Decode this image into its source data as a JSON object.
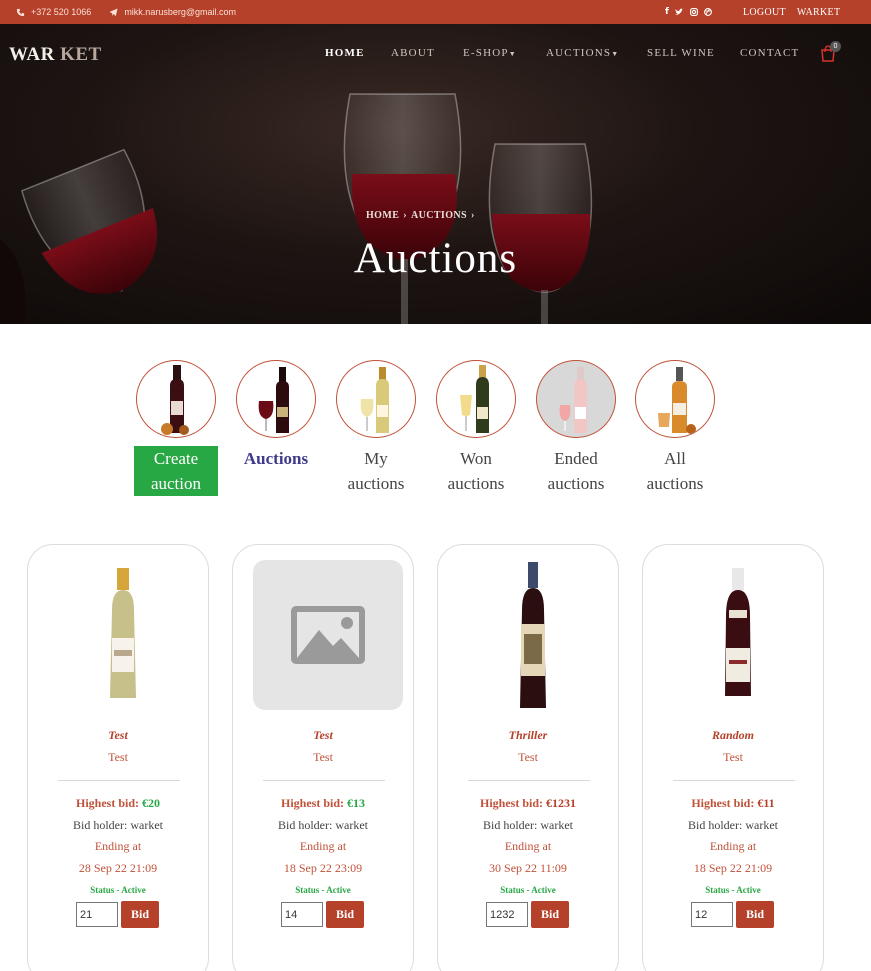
{
  "topbar": {
    "phone": "+372 520 1066",
    "email": "mikk.narusberg@gmail.com",
    "social_icons": [
      "facebook-icon",
      "twitter-icon",
      "instagram-icon",
      "dribbble-icon"
    ],
    "logout": "LOGOUT",
    "user": "WARKET"
  },
  "header": {
    "brand_part1": "WAR",
    "brand_part2": "KET",
    "nav": {
      "home": "HOME",
      "about": "ABOUT",
      "eshop": "E-SHOP",
      "auctions": "AUCTIONS",
      "sell": "SELL WINE",
      "contact": "CONTACT"
    },
    "cart_count": "0"
  },
  "hero": {
    "crumb_home": "HOME",
    "crumb_auctions": "AUCTIONS",
    "title": "Auctions"
  },
  "categories": [
    {
      "line1": "Create",
      "line2": "auction"
    },
    {
      "line1": "Auctions",
      "line2": ""
    },
    {
      "line1": "My",
      "line2": "auctions"
    },
    {
      "line1": "Won",
      "line2": "auctions"
    },
    {
      "line1": "Ended",
      "line2": "auctions"
    },
    {
      "line1": "All",
      "line2": "auctions"
    }
  ],
  "auctions": [
    {
      "name": "Test",
      "desc": "Test",
      "highest_label": "Highest bid:",
      "amount": "€20",
      "holder": "Bid holder: warket",
      "ending_label": "Ending at",
      "date": "28 Sep 22 21:09",
      "status": "Status - Active",
      "bid_value": "21",
      "bid_button": "Bid"
    },
    {
      "name": "Test",
      "desc": "Test",
      "highest_label": "Highest bid:",
      "amount": "€13",
      "holder": "Bid holder: warket",
      "ending_label": "Ending at",
      "date": "18 Sep 22 23:09",
      "status": "Status - Active",
      "bid_value": "14",
      "bid_button": "Bid"
    },
    {
      "name": "Thriller",
      "desc": "Test",
      "highest_label": "Highest bid:",
      "amount": "€1231",
      "holder": "Bid holder: warket",
      "ending_label": "Ending at",
      "date": "30 Sep 22 11:09",
      "status": "Status - Active",
      "bid_value": "1232",
      "bid_button": "Bid"
    },
    {
      "name": "Random",
      "desc": "Test",
      "highest_label": "Highest bid:",
      "amount": "€11",
      "holder": "Bid holder: warket",
      "ending_label": "Ending at",
      "date": "18 Sep 22 21:09",
      "status": "Status - Active",
      "bid_value": "12",
      "bid_button": "Bid"
    }
  ],
  "colors": {
    "accent": "#b5412a",
    "active_green": "#28a745",
    "active_link": "#3e3a8c"
  }
}
